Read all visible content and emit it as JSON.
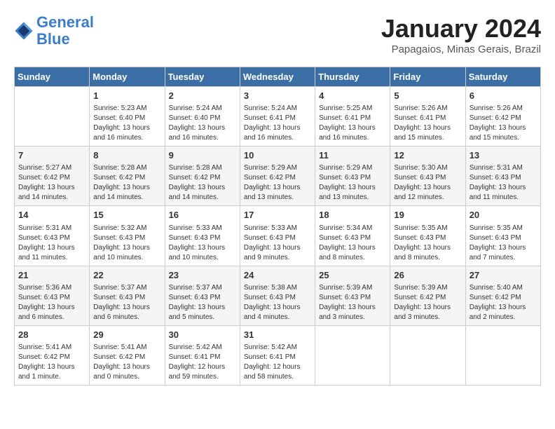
{
  "logo": {
    "line1": "General",
    "line2": "Blue"
  },
  "title": "January 2024",
  "subtitle": "Papagaios, Minas Gerais, Brazil",
  "days_of_week": [
    "Sunday",
    "Monday",
    "Tuesday",
    "Wednesday",
    "Thursday",
    "Friday",
    "Saturday"
  ],
  "weeks": [
    [
      {
        "day": "",
        "info": ""
      },
      {
        "day": "1",
        "info": "Sunrise: 5:23 AM\nSunset: 6:40 PM\nDaylight: 13 hours\nand 16 minutes."
      },
      {
        "day": "2",
        "info": "Sunrise: 5:24 AM\nSunset: 6:40 PM\nDaylight: 13 hours\nand 16 minutes."
      },
      {
        "day": "3",
        "info": "Sunrise: 5:24 AM\nSunset: 6:41 PM\nDaylight: 13 hours\nand 16 minutes."
      },
      {
        "day": "4",
        "info": "Sunrise: 5:25 AM\nSunset: 6:41 PM\nDaylight: 13 hours\nand 16 minutes."
      },
      {
        "day": "5",
        "info": "Sunrise: 5:26 AM\nSunset: 6:41 PM\nDaylight: 13 hours\nand 15 minutes."
      },
      {
        "day": "6",
        "info": "Sunrise: 5:26 AM\nSunset: 6:42 PM\nDaylight: 13 hours\nand 15 minutes."
      }
    ],
    [
      {
        "day": "7",
        "info": "Sunrise: 5:27 AM\nSunset: 6:42 PM\nDaylight: 13 hours\nand 14 minutes."
      },
      {
        "day": "8",
        "info": "Sunrise: 5:28 AM\nSunset: 6:42 PM\nDaylight: 13 hours\nand 14 minutes."
      },
      {
        "day": "9",
        "info": "Sunrise: 5:28 AM\nSunset: 6:42 PM\nDaylight: 13 hours\nand 14 minutes."
      },
      {
        "day": "10",
        "info": "Sunrise: 5:29 AM\nSunset: 6:42 PM\nDaylight: 13 hours\nand 13 minutes."
      },
      {
        "day": "11",
        "info": "Sunrise: 5:29 AM\nSunset: 6:43 PM\nDaylight: 13 hours\nand 13 minutes."
      },
      {
        "day": "12",
        "info": "Sunrise: 5:30 AM\nSunset: 6:43 PM\nDaylight: 13 hours\nand 12 minutes."
      },
      {
        "day": "13",
        "info": "Sunrise: 5:31 AM\nSunset: 6:43 PM\nDaylight: 13 hours\nand 11 minutes."
      }
    ],
    [
      {
        "day": "14",
        "info": "Sunrise: 5:31 AM\nSunset: 6:43 PM\nDaylight: 13 hours\nand 11 minutes."
      },
      {
        "day": "15",
        "info": "Sunrise: 5:32 AM\nSunset: 6:43 PM\nDaylight: 13 hours\nand 10 minutes."
      },
      {
        "day": "16",
        "info": "Sunrise: 5:33 AM\nSunset: 6:43 PM\nDaylight: 13 hours\nand 10 minutes."
      },
      {
        "day": "17",
        "info": "Sunrise: 5:33 AM\nSunset: 6:43 PM\nDaylight: 13 hours\nand 9 minutes."
      },
      {
        "day": "18",
        "info": "Sunrise: 5:34 AM\nSunset: 6:43 PM\nDaylight: 13 hours\nand 8 minutes."
      },
      {
        "day": "19",
        "info": "Sunrise: 5:35 AM\nSunset: 6:43 PM\nDaylight: 13 hours\nand 8 minutes."
      },
      {
        "day": "20",
        "info": "Sunrise: 5:35 AM\nSunset: 6:43 PM\nDaylight: 13 hours\nand 7 minutes."
      }
    ],
    [
      {
        "day": "21",
        "info": "Sunrise: 5:36 AM\nSunset: 6:43 PM\nDaylight: 13 hours\nand 6 minutes."
      },
      {
        "day": "22",
        "info": "Sunrise: 5:37 AM\nSunset: 6:43 PM\nDaylight: 13 hours\nand 6 minutes."
      },
      {
        "day": "23",
        "info": "Sunrise: 5:37 AM\nSunset: 6:43 PM\nDaylight: 13 hours\nand 5 minutes."
      },
      {
        "day": "24",
        "info": "Sunrise: 5:38 AM\nSunset: 6:43 PM\nDaylight: 13 hours\nand 4 minutes."
      },
      {
        "day": "25",
        "info": "Sunrise: 5:39 AM\nSunset: 6:43 PM\nDaylight: 13 hours\nand 3 minutes."
      },
      {
        "day": "26",
        "info": "Sunrise: 5:39 AM\nSunset: 6:42 PM\nDaylight: 13 hours\nand 3 minutes."
      },
      {
        "day": "27",
        "info": "Sunrise: 5:40 AM\nSunset: 6:42 PM\nDaylight: 13 hours\nand 2 minutes."
      }
    ],
    [
      {
        "day": "28",
        "info": "Sunrise: 5:41 AM\nSunset: 6:42 PM\nDaylight: 13 hours\nand 1 minute."
      },
      {
        "day": "29",
        "info": "Sunrise: 5:41 AM\nSunset: 6:42 PM\nDaylight: 13 hours\nand 0 minutes."
      },
      {
        "day": "30",
        "info": "Sunrise: 5:42 AM\nSunset: 6:41 PM\nDaylight: 12 hours\nand 59 minutes."
      },
      {
        "day": "31",
        "info": "Sunrise: 5:42 AM\nSunset: 6:41 PM\nDaylight: 12 hours\nand 58 minutes."
      },
      {
        "day": "",
        "info": ""
      },
      {
        "day": "",
        "info": ""
      },
      {
        "day": "",
        "info": ""
      }
    ]
  ]
}
